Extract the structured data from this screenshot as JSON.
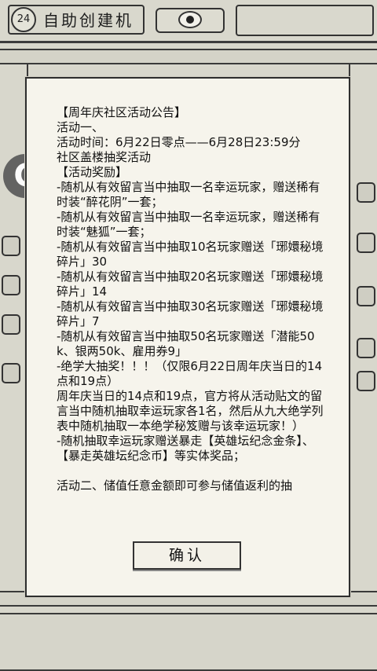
{
  "header": {
    "level": "24",
    "title": "自助创建机"
  },
  "logo": {
    "letter": "C"
  },
  "dialog": {
    "lines": [
      "【周年庆社区活动公告】",
      "活动一、",
      "活动时间：6月22日零点——6月28日23:59分",
      "社区盖楼抽奖活动",
      "【活动奖励】",
      "-随机从有效留言当中抽取一名幸运玩家，赠送稀有时装“醉花阴”一套；",
      "-随机从有效留言当中抽取一名幸运玩家，赠送稀有时装“魅狐”一套；",
      "-随机从有效留言当中抽取10名玩家赠送「琊嬛秘境碎片」30",
      "-随机从有效留言当中抽取20名玩家赠送「琊嬛秘境碎片」14",
      "-随机从有效留言当中抽取30名玩家赠送「琊嬛秘境碎片」7",
      "-随机从有效留言当中抽取50名玩家赠送「潜能50k、银两50k、雇用券9」",
      "-绝学大抽奖！！！（仅限6月22日周年庆当日的14点和19点）",
      "周年庆当日的14点和19点，官方将从活动贴文的留言当中随机抽取幸运玩家各1名，然后从九大绝学列表中随机抽取一本绝学秘笈赠与该幸运玩家！）",
      "-随机抽取幸运玩家赠送暴走【英雄坛纪念金条】、【暴走英雄坛纪念币】等实体奖品；",
      "",
      "活动二、储值任意金额即可参与储值返利的抽"
    ],
    "confirm_label": "确认"
  }
}
